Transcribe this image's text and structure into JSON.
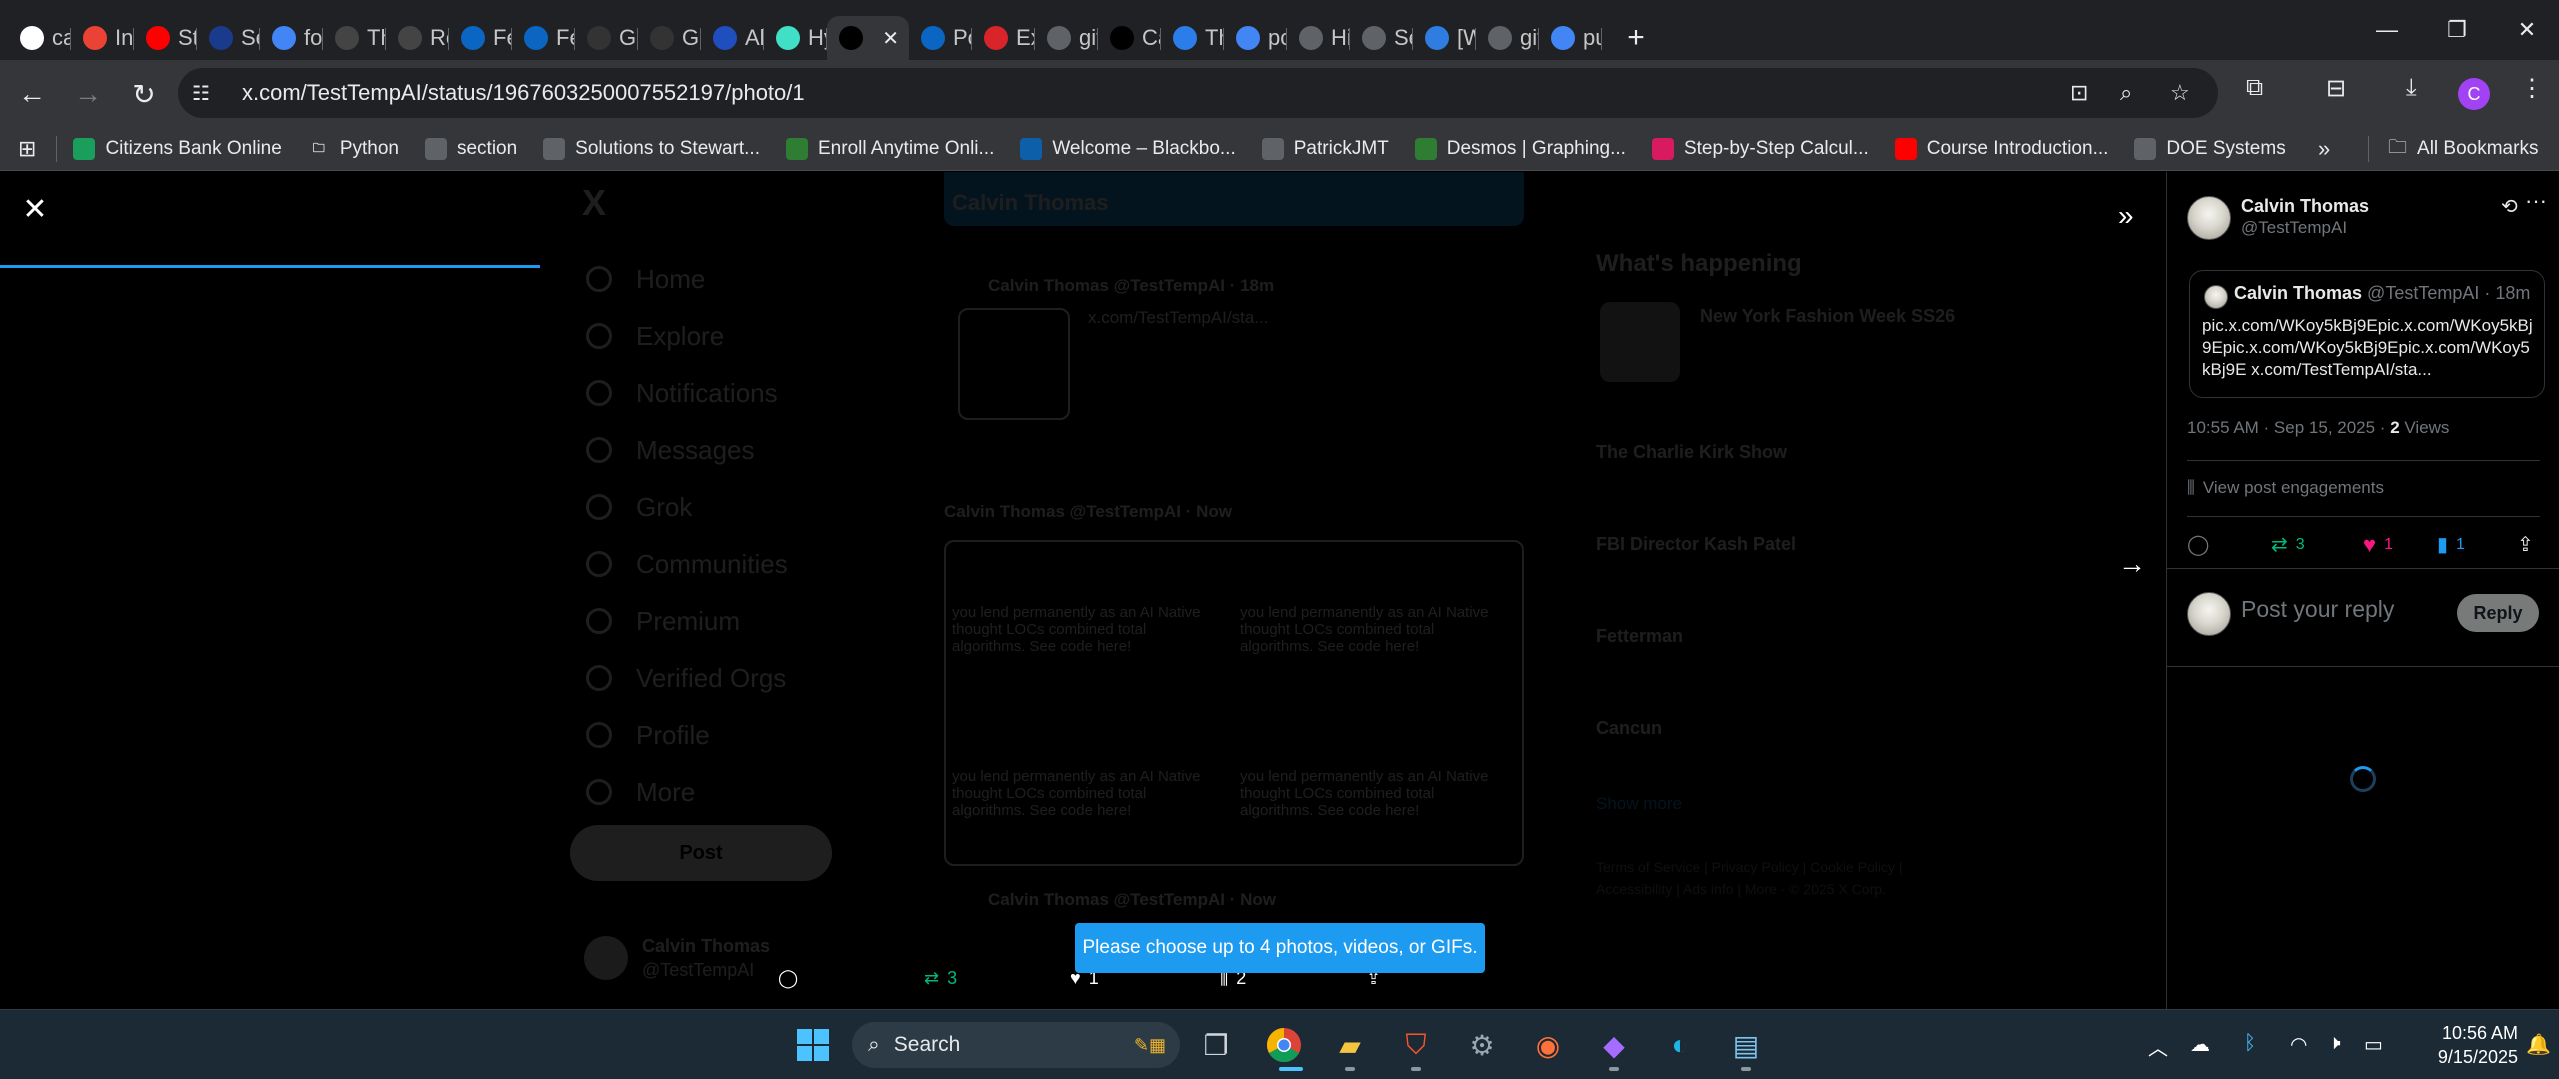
{
  "browser": {
    "tabs": [
      {
        "label": "ca",
        "icon": "github-icon",
        "color": "#ffffff"
      },
      {
        "label": "Inl",
        "icon": "gmail-icon",
        "color": "#ea4335"
      },
      {
        "label": "Stu",
        "icon": "youtube-icon",
        "color": "#ff0000"
      },
      {
        "label": "Se",
        "icon": "ssn-icon",
        "color": "#1a3b8b"
      },
      {
        "label": "for",
        "icon": "google-icon",
        "color": "#4285f4"
      },
      {
        "label": "Th",
        "icon": "r-icon",
        "color": "#444444"
      },
      {
        "label": "Re",
        "icon": "r-icon",
        "color": "#444444"
      },
      {
        "label": "Fe",
        "icon": "linkedin-icon",
        "color": "#0a66c2"
      },
      {
        "label": "Fe",
        "icon": "linkedin-icon",
        "color": "#0a66c2"
      },
      {
        "label": "Gr",
        "icon": "grok-icon",
        "color": "#333333"
      },
      {
        "label": "Gr",
        "icon": "grok-icon",
        "color": "#333333"
      },
      {
        "label": "Al",
        "icon": "al-icon",
        "color": "#1f4fbf"
      },
      {
        "label": "Hy",
        "icon": "hy-icon",
        "color": "#3fe0c5"
      },
      {
        "label": "",
        "icon": "x-icon",
        "color": "#000000",
        "active": true
      },
      {
        "label": "Po",
        "icon": "linkedin-icon",
        "color": "#0a66c2"
      },
      {
        "label": "Ex",
        "icon": "ex-icon",
        "color": "#d9252a"
      },
      {
        "label": "git",
        "icon": "globe-icon",
        "color": "#5f6368"
      },
      {
        "label": "Ca",
        "icon": "x-icon",
        "color": "#000000"
      },
      {
        "label": "Th",
        "icon": "th-icon",
        "color": "#2b7de9"
      },
      {
        "label": "pc",
        "icon": "google-icon",
        "color": "#4285f4"
      },
      {
        "label": "Hi",
        "icon": "history-icon",
        "color": "#5f6368"
      },
      {
        "label": "Se",
        "icon": "gear-icon",
        "color": "#5f6368"
      },
      {
        "label": "[W",
        "icon": "w-icon",
        "color": "#2f7de1"
      },
      {
        "label": "git",
        "icon": "globe-icon",
        "color": "#5f6368"
      },
      {
        "label": "pu",
        "icon": "google-icon",
        "color": "#4285f4"
      }
    ],
    "url": "x.com/TestTempAI/status/1967603250007552197/photo/1",
    "profile_initial": "C"
  },
  "bookmarks": {
    "items": [
      {
        "label": "Citizens Bank Online",
        "color": "#1a9e5c"
      },
      {
        "label": "Python",
        "color": "#5f6368",
        "folder": true
      },
      {
        "label": "section",
        "color": "#5f6368"
      },
      {
        "label": "Solutions to Stewart...",
        "color": "#5f6368"
      },
      {
        "label": "Enroll Anytime Onli...",
        "color": "#2e7d32"
      },
      {
        "label": "Welcome – Blackbo...",
        "color": "#0c5fa8"
      },
      {
        "label": "PatrickJMT",
        "color": "#5f6368"
      },
      {
        "label": "Desmos | Graphing...",
        "color": "#2e7d32"
      },
      {
        "label": "Step-by-Step Calcul...",
        "color": "#d81b60"
      },
      {
        "label": "Course Introduction...",
        "color": "#ff0000"
      },
      {
        "label": "DOE Systems",
        "color": "#5f6368"
      }
    ],
    "all_bookmarks": "All Bookmarks"
  },
  "background_page": {
    "logo": "X",
    "nav": [
      "Home",
      "Explore",
      "Notifications",
      "Messages",
      "Grok",
      "Communities",
      "Premium",
      "Verified Orgs",
      "Profile",
      "More"
    ],
    "post_button": "Post",
    "header_name": "Calvin Thomas",
    "feed_names": [
      "Calvin Thomas @TestTempAI · 18m",
      "Calvin Thomas @TestTempAI · Now",
      "Calvin Thomas @TestTempAI · Now"
    ],
    "feed_link": "x.com/TestTempAI/sta...",
    "feed_text": "you lend permanently as an AI Native thought LOCs combined total algorithms. See code here!",
    "whats_happening": "What's happening",
    "trends": [
      "New York Fashion Week SS26",
      "The Charlie Kirk Show",
      "FBI Director Kash Patel",
      "Fetterman",
      "Cancun"
    ],
    "show_more": "Show more",
    "footer": "Terms of Service | Privacy Policy | Cookie Policy | Accessibility | Ads info | More · © 2025 X Corp.",
    "account_name": "Calvin Thomas",
    "account_handle": "@TestTempAI"
  },
  "viewer": {
    "actions": {
      "retweets": "3",
      "likes": "1",
      "views": "2"
    },
    "toast": "Please choose up to 4 photos, videos, or GIFs."
  },
  "side_panel": {
    "author_name": "Calvin Thomas",
    "author_handle": "@TestTempAI",
    "quote": {
      "name": "Calvin Thomas",
      "handle_time": "@TestTempAI · 18m",
      "body": "pic.x.com/WKoy5kBj9Epic.x.com/WKoy5kBj9Epic.x.com/WKoy5kBj9Epic.x.com/WKoy5kBj9E x.com/TestTempAI/sta..."
    },
    "timestamp": "10:55 AM · Sep 15, 2025 · ",
    "views_count": "2",
    "views_label": " Views",
    "view_engagements": "View post engagements",
    "stats": {
      "retweets": "3",
      "likes": "1",
      "bookmarks": "1"
    },
    "reply_placeholder": "Post your reply",
    "reply_button": "Reply"
  },
  "taskbar": {
    "search_placeholder": "Search",
    "time": "10:56 AM",
    "date": "9/15/2025"
  }
}
